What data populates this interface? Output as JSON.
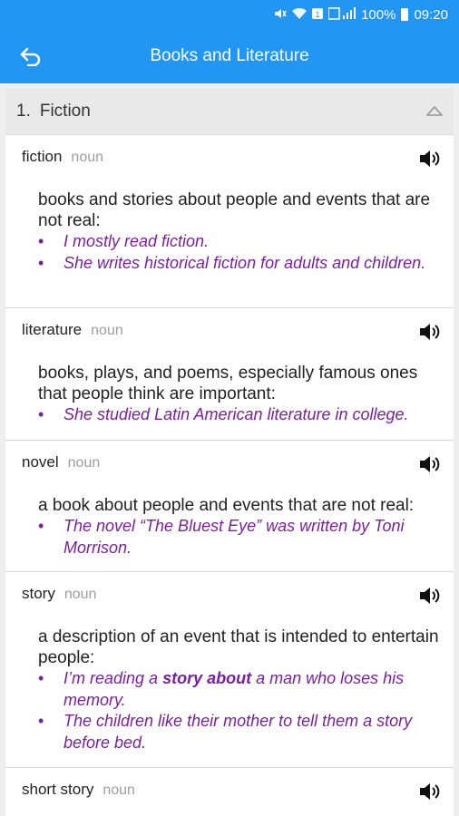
{
  "status": {
    "battery": "100%",
    "time": "09:20",
    "icons": [
      "mute-icon",
      "wifi-icon",
      "message-icon",
      "signal-icon",
      "battery-icon"
    ]
  },
  "appbar": {
    "title": "Books and Literature",
    "back_icon": "back-icon"
  },
  "section": {
    "number": "1.",
    "name": "Fiction"
  },
  "entries": [
    {
      "word": "fiction",
      "pos": "noun",
      "definition": "books and stories about people and events that are not real:",
      "examples": [
        "I mostly read fiction.",
        "She writes historical fiction for adults and children."
      ]
    },
    {
      "word": "literature",
      "pos": "noun",
      "definition": "books, plays, and poems, especially famous ones that people think are important:",
      "examples": [
        "She studied Latin American literature in college."
      ]
    },
    {
      "word": "novel",
      "pos": "noun",
      "definition": "a book about people and events that are not real:",
      "examples": [
        "The novel “The Bluest Eye” was written by Toni Morrison."
      ]
    },
    {
      "word": "story",
      "pos": "noun",
      "definition": "a description of an event that is intended to entertain people:",
      "examples_rich": [
        {
          "before": "I’m reading a ",
          "bold": "story about",
          "after": " a man who loses his memory."
        },
        {
          "before": "The children like their mother to tell them a story before bed.",
          "bold": "",
          "after": ""
        }
      ]
    },
    {
      "word": "short story",
      "pos": "noun"
    }
  ],
  "colors": {
    "accent": "#2196f3",
    "example": "#7b1fa2",
    "pos": "#9e9e9e"
  }
}
